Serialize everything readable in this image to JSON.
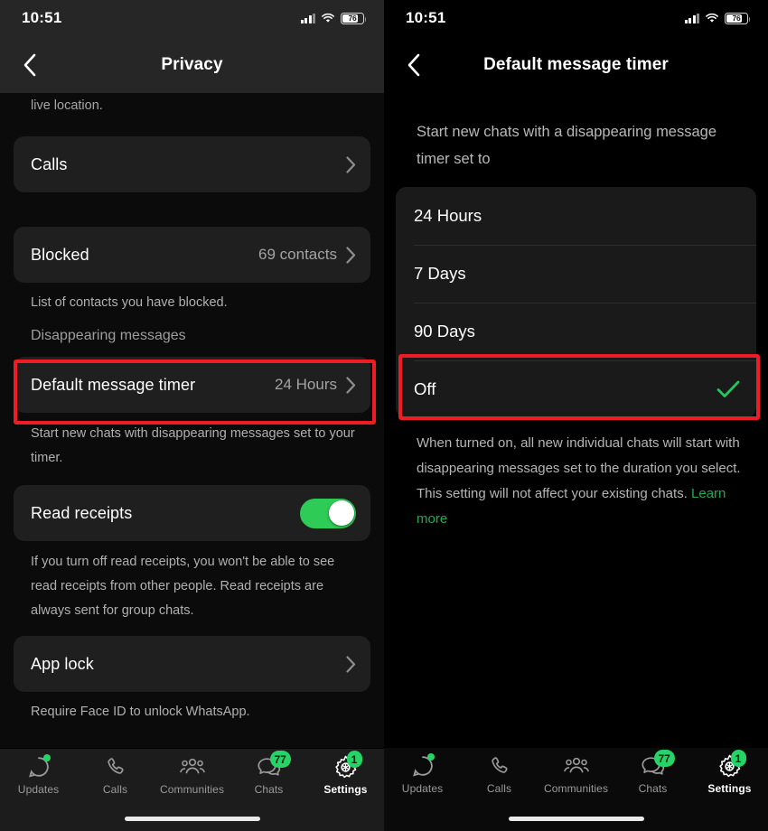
{
  "status_bar": {
    "time": "10:51",
    "battery_percent": "76",
    "wifi_icon": "wifi-icon",
    "signal_icon": "cellular-signal-icon",
    "battery_icon": "battery-icon"
  },
  "left_screen": {
    "nav": {
      "back_icon": "chevron-left-icon",
      "title": "Privacy"
    },
    "cut_text": "live location.",
    "rows": [
      {
        "label": "Calls",
        "value": "",
        "chevron": "chevron-right-icon"
      },
      {
        "label": "Blocked",
        "value": "69 contacts",
        "chevron": "chevron-right-icon"
      }
    ],
    "blocked_footnote": "List of contacts you have blocked.",
    "section_heading": "Disappearing messages",
    "timer_row": {
      "label": "Default message timer",
      "value": "24 Hours",
      "chevron": "chevron-right-icon"
    },
    "timer_footnote": "Start new chats with disappearing messages set to your timer.",
    "read_receipts": {
      "label": "Read receipts",
      "toggle_state": "on",
      "toggle_color": "#2ecc57"
    },
    "read_receipts_footnote": "If you turn off read receipts, you won't be able to see read receipts from other people. Read receipts are always sent for group chats.",
    "app_lock": {
      "label": "App lock",
      "chevron": "chevron-right-icon"
    },
    "app_lock_footnote": "Require Face ID to unlock WhatsApp."
  },
  "right_screen": {
    "nav": {
      "back_icon": "chevron-left-icon",
      "title": "Default message timer"
    },
    "intro": "Start new chats with a disappearing message timer set to",
    "options": [
      {
        "label": "24 Hours",
        "selected": false
      },
      {
        "label": "7 Days",
        "selected": false
      },
      {
        "label": "90 Days",
        "selected": false
      },
      {
        "label": "Off",
        "selected": true
      }
    ],
    "check_icon": "checkmark-icon",
    "check_color": "#23c55e",
    "footnote": "When turned on, all new individual chats will start with disappearing messages set to the duration you select. This setting will not affect your existing chats. ",
    "learn_more": "Learn more",
    "learn_more_color": "#1fa855"
  },
  "tab_bar": {
    "items": [
      {
        "label": "Updates",
        "icon": "updates-status-icon",
        "badge": "",
        "dot": true,
        "active": false
      },
      {
        "label": "Calls",
        "icon": "phone-icon",
        "badge": "",
        "dot": false,
        "active": false
      },
      {
        "label": "Communities",
        "icon": "communities-people-icon",
        "badge": "",
        "dot": false,
        "active": false
      },
      {
        "label": "Chats",
        "icon": "chat-bubbles-icon",
        "badge": "77",
        "dot": false,
        "active": false
      },
      {
        "label": "Settings",
        "icon": "gear-icon",
        "badge": "1",
        "dot": false,
        "active": true
      }
    ],
    "badge_color": "#25d366",
    "home_indicator": "home-indicator"
  },
  "highlights": {
    "color": "#ee1c25",
    "left_target": "Default message timer",
    "right_target": "Off"
  }
}
